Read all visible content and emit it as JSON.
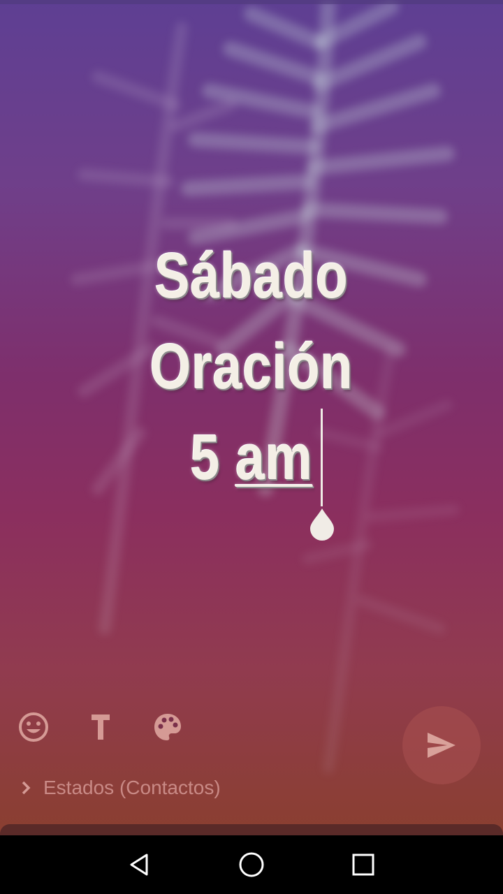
{
  "status_text": {
    "line1": "Sábado",
    "line2": "Oración",
    "line3_number": "5",
    "line3_unit": "am"
  },
  "toolbar": {
    "emoji_icon": "emoji-smile-icon",
    "text_icon": "text-font-icon",
    "color_icon": "palette-icon",
    "send_icon": "send-arrow-icon"
  },
  "audience": {
    "label": "Estados (Contactos)",
    "icon": "chevron-right-icon"
  },
  "navigation": {
    "back_icon": "back-triangle-icon",
    "home_icon": "home-circle-icon",
    "recents_icon": "recents-square-icon"
  },
  "colors": {
    "text_color": "#f4efe6",
    "icon_color": "#c98a86",
    "send_bg": "#aa5050",
    "gradient_top": "#5e3f93",
    "gradient_bottom": "#8a3f30"
  }
}
